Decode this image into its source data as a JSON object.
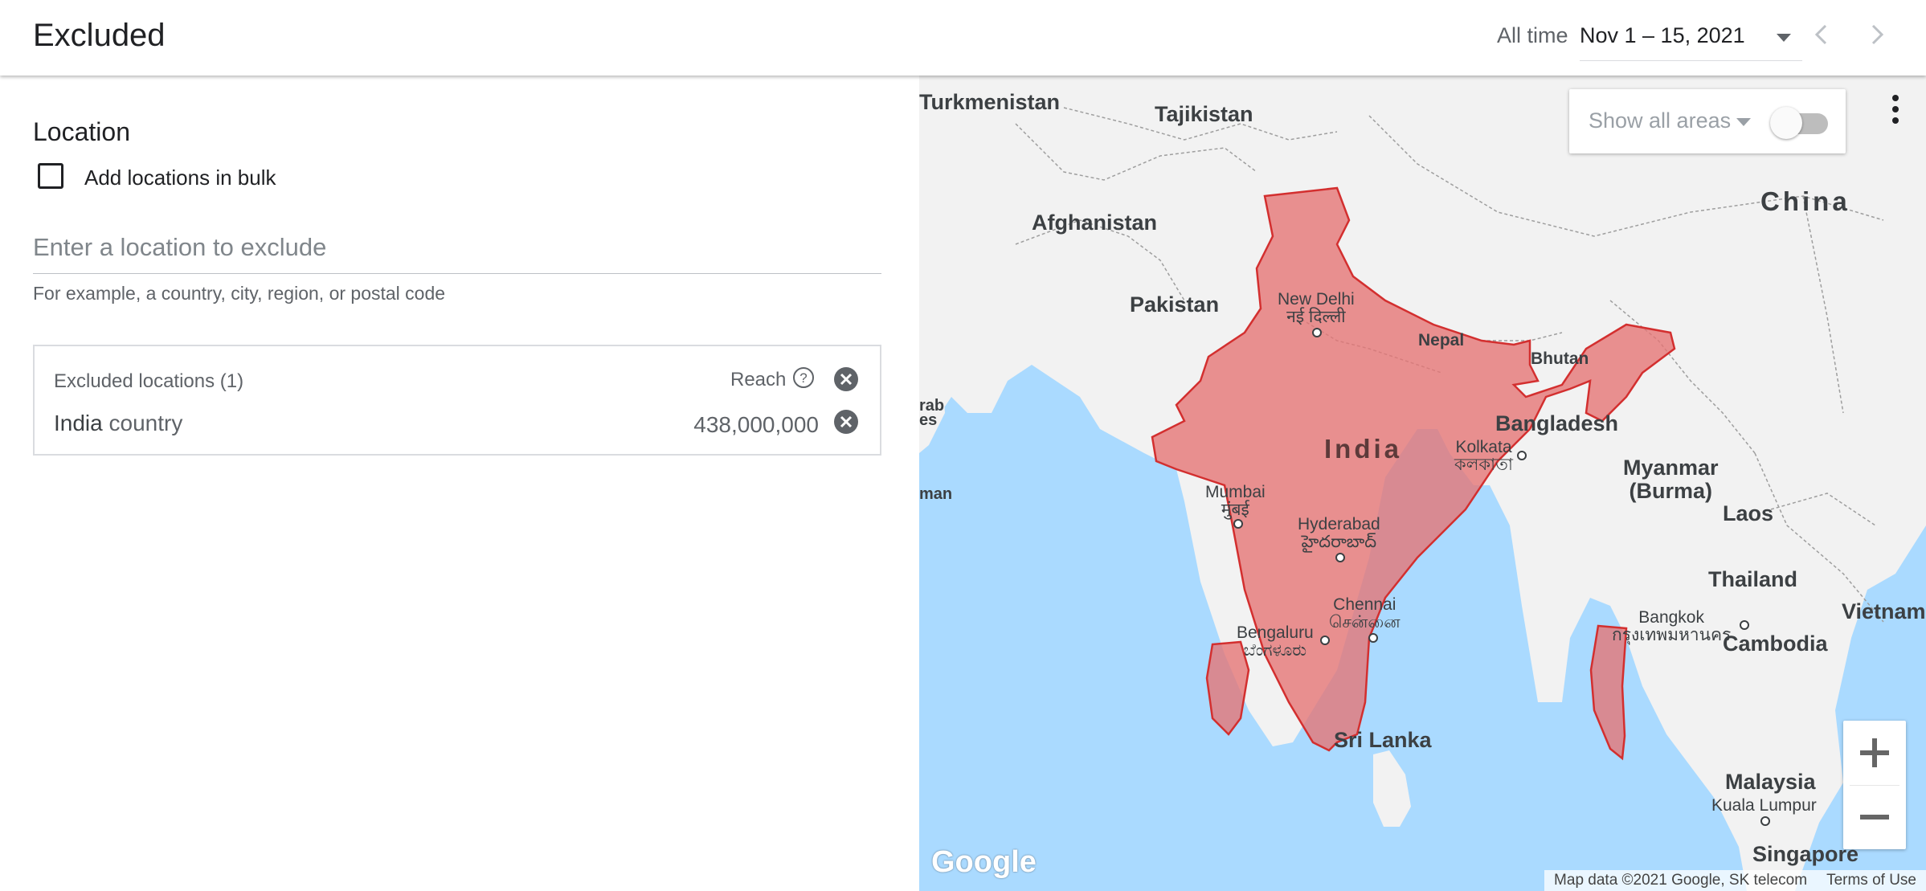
{
  "header": {
    "title": "Excluded",
    "date_range_label": "All time",
    "date_range_value": "Nov 1 – 15, 2021"
  },
  "location": {
    "section_title": "Location",
    "bulk_label": "Add locations in bulk",
    "bulk_checked": false,
    "input_placeholder": "Enter a location to exclude",
    "input_value": "",
    "helper_text": "For example, a country, city, region, or postal code",
    "excluded": {
      "header": "Excluded locations (1)",
      "reach_label": "Reach",
      "rows": [
        {
          "name": "India",
          "type": "country",
          "reach": "438,000,000"
        }
      ]
    }
  },
  "map": {
    "show_areas_label": "Show all areas",
    "show_areas_on": false,
    "countries": {
      "turkmenistan": "Turkmenistan",
      "tajikistan": "Tajikistan",
      "afghanistan": "Afghanistan",
      "pakistan": "Pakistan",
      "china": "China",
      "nepal": "Nepal",
      "bhutan": "Bhutan",
      "india": "India",
      "bangladesh": "Bangladesh",
      "myanmar": "Myanmar\n(Burma)",
      "laos": "Laos",
      "thailand": "Thailand",
      "vietnam": "Vietnam",
      "cambodia": "Cambodia",
      "sri_lanka": "Sri Lanka",
      "malaysia": "Malaysia",
      "singapore": "Singapore",
      "oman": "man",
      "uae": "rab\nes"
    },
    "cities": {
      "new_delhi": "New Delhi\nनई दिल्ली",
      "kolkata": "Kolkata\nকলকাতা",
      "mumbai": "Mumbai\nमुंबई",
      "hyderabad": "Hyderabad\nహైదరాబాద్",
      "chennai": "Chennai\nசென்னை",
      "bengaluru": "Bengaluru\nಬೆಂಗಳೂರು",
      "bangkok": "Bangkok\nกรุงเทพมหานคร",
      "kuala_lumpur": "Kuala Lumpur"
    },
    "google_logo": "Google",
    "attribution": "Map data ©2021 Google, SK telecom",
    "terms": "Terms of Use",
    "colors": {
      "water": "#aadaff",
      "land": "#f2f2f2",
      "excluded_fill": "#e57373",
      "excluded_stroke": "#d32f2f"
    }
  }
}
